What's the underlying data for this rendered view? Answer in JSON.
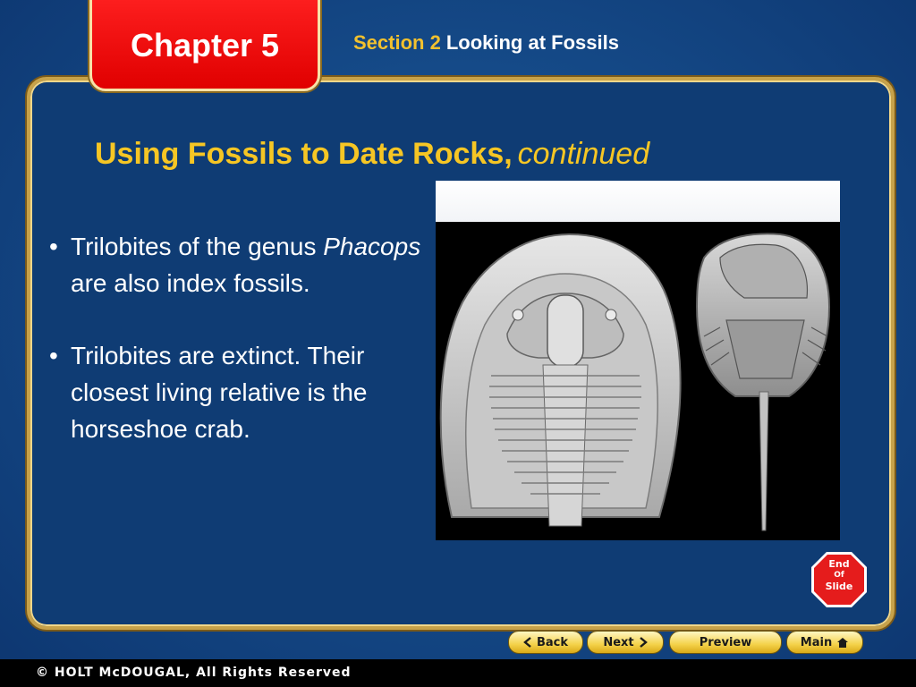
{
  "header": {
    "chapter_label": "Chapter 5",
    "section_label": "Section 2",
    "section_title": "Looking at Fossils"
  },
  "slide": {
    "title_main": "Using Fossils to Date Rocks,",
    "title_suffix": "continued",
    "bullets": [
      {
        "text_pre": "Trilobites of the genus ",
        "text_italic": "Phacops",
        "text_post": " are also index fossils."
      },
      {
        "text": "Trilobites are extinct. Their closest living relative is the horseshoe crab."
      }
    ],
    "bullet_glyph": "•"
  },
  "end_slide": {
    "line1": "End",
    "line2": "Of",
    "line3": "Slide",
    "color": "#e51c1c"
  },
  "nav": {
    "back": "Back",
    "next": "Next",
    "preview": "Preview",
    "main": "Main"
  },
  "footer": {
    "copyright": "© HOLT McDOUGAL, All Rights Reserved"
  },
  "colors": {
    "title_yellow": "#f6c624",
    "tab_red": "#e00000",
    "panel_blue": "#0f3c74",
    "nav_gold": "#f4d24a"
  },
  "icons": [
    "chevron-left-icon",
    "chevron-right-icon",
    "home-icon",
    "stop-sign-icon"
  ]
}
